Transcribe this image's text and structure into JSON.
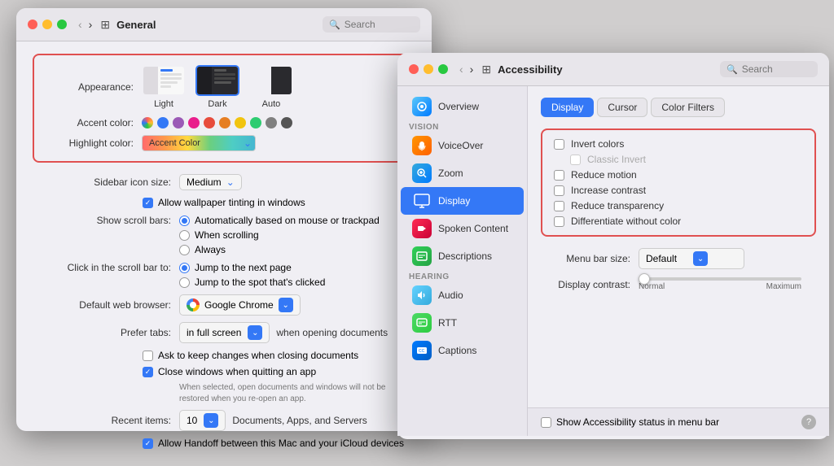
{
  "general_window": {
    "title": "General",
    "search_placeholder": "Search",
    "appearance": {
      "label": "Appearance:",
      "options": [
        {
          "id": "light",
          "label": "Light",
          "selected": false
        },
        {
          "id": "dark",
          "label": "Dark",
          "selected": false
        },
        {
          "id": "auto",
          "label": "Auto",
          "selected": false
        }
      ]
    },
    "accent_color": {
      "label": "Accent color:",
      "colors": [
        {
          "name": "multicolor",
          "color": "conic-gradient(red, yellow, green, blue, red)"
        },
        {
          "name": "blue",
          "color": "#3478f6"
        },
        {
          "name": "purple",
          "color": "#9b59b6"
        },
        {
          "name": "pink",
          "color": "#e91e8c"
        },
        {
          "name": "red",
          "color": "#e74c3c"
        },
        {
          "name": "orange",
          "color": "#e67e22"
        },
        {
          "name": "yellow",
          "color": "#f1c40f"
        },
        {
          "name": "green",
          "color": "#2ecc71"
        },
        {
          "name": "graphite",
          "color": "#808080"
        },
        {
          "name": "dark-gray",
          "color": "#555"
        }
      ]
    },
    "highlight_color": {
      "label": "Highlight color:",
      "value": "Accent Color"
    },
    "sidebar_icon_size": {
      "label": "Sidebar icon size:",
      "value": "Medium"
    },
    "allow_wallpaper_tinting": {
      "label": "Allow wallpaper tinting in windows",
      "checked": true
    },
    "show_scroll_bars": {
      "label": "Show scroll bars:",
      "options": [
        {
          "label": "Automatically based on mouse or trackpad",
          "selected": true
        },
        {
          "label": "When scrolling",
          "selected": false
        },
        {
          "label": "Always",
          "selected": false
        }
      ]
    },
    "click_scroll_bar": {
      "label": "Click in the scroll bar to:",
      "options": [
        {
          "label": "Jump to the next page",
          "selected": true
        },
        {
          "label": "Jump to the spot that's clicked",
          "selected": false
        }
      ]
    },
    "default_web_browser": {
      "label": "Default web browser:",
      "value": "Google Chrome"
    },
    "prefer_tabs": {
      "label": "Prefer tabs:",
      "value": "in full screen",
      "suffix": "when opening documents"
    },
    "ask_keep_changes": {
      "label": "Ask to keep changes when closing documents",
      "checked": false
    },
    "close_windows_quitting": {
      "label": "Close windows when quitting an app",
      "checked": true,
      "note": "When selected, open documents and windows will not be restored when you re-open an app."
    },
    "recent_items": {
      "label": "Recent items:",
      "count": "10",
      "suffix": "Documents, Apps, and Servers"
    },
    "allow_handoff": {
      "label": "Allow Handoff between this Mac and your iCloud devices",
      "checked": true
    }
  },
  "accessibility_window": {
    "title": "Accessibility",
    "search_placeholder": "Search",
    "sidebar": {
      "vision_label": "Vision",
      "items": [
        {
          "id": "overview",
          "label": "Overview",
          "active": false
        },
        {
          "id": "voiceover",
          "label": "VoiceOver",
          "active": false
        },
        {
          "id": "zoom",
          "label": "Zoom",
          "active": false
        },
        {
          "id": "display",
          "label": "Display",
          "active": true
        },
        {
          "id": "spoken-content",
          "label": "Spoken Content",
          "active": false
        },
        {
          "id": "descriptions",
          "label": "Descriptions",
          "active": false
        }
      ],
      "hearing_label": "Hearing",
      "hearing_items": [
        {
          "id": "audio",
          "label": "Audio",
          "active": false
        },
        {
          "id": "rtt",
          "label": "RTT",
          "active": false
        },
        {
          "id": "captions",
          "label": "Captions",
          "active": false
        }
      ]
    },
    "tabs": [
      {
        "id": "display",
        "label": "Display",
        "active": true
      },
      {
        "id": "cursor",
        "label": "Cursor",
        "active": false
      },
      {
        "id": "color-filters",
        "label": "Color Filters",
        "active": false
      }
    ],
    "display_options": {
      "invert_colors": {
        "label": "Invert colors",
        "checked": false
      },
      "classic_invert": {
        "label": "Classic Invert",
        "checked": false,
        "disabled": true
      },
      "reduce_motion": {
        "label": "Reduce motion",
        "checked": false
      },
      "increase_contrast": {
        "label": "Increase contrast",
        "checked": false
      },
      "reduce_transparency": {
        "label": "Reduce transparency",
        "checked": false
      },
      "differentiate_without_color": {
        "label": "Differentiate without color",
        "checked": false
      }
    },
    "menu_bar_size": {
      "label": "Menu bar size:",
      "value": "Default"
    },
    "display_contrast": {
      "label": "Display contrast:",
      "min_label": "Normal",
      "max_label": "Maximum"
    },
    "status_bar": {
      "show_status": "Show Accessibility status in menu bar"
    }
  }
}
